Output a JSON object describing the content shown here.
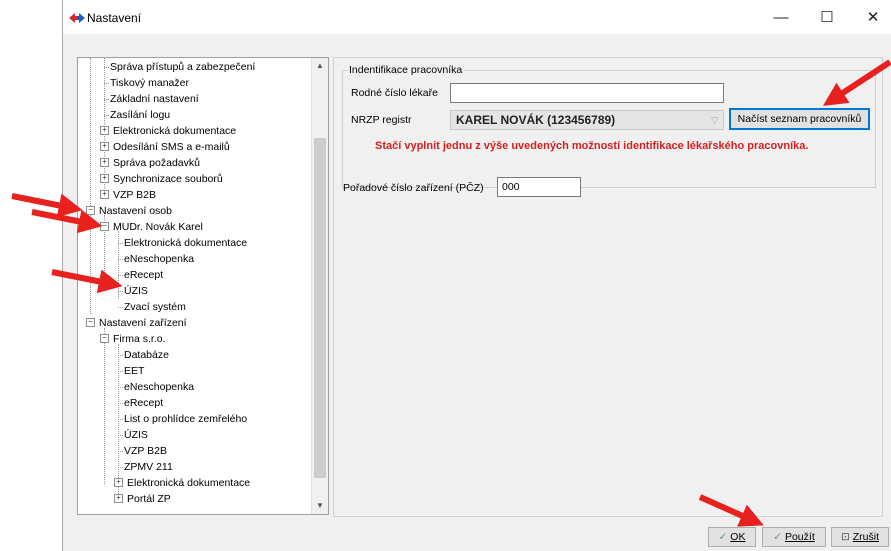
{
  "window": {
    "title": "Nastavení",
    "controls": {
      "minimize": "—",
      "maximize": "☐",
      "close": "✕"
    }
  },
  "tree": {
    "items": [
      {
        "label": "Správa přístupů a zabezpečení"
      },
      {
        "label": "Tiskový manažer"
      },
      {
        "label": "Základní nastavení"
      },
      {
        "label": "Zasílání logu"
      },
      {
        "label": "Elektronická dokumentace"
      },
      {
        "label": "Odesílání SMS a e-mailů"
      },
      {
        "label": "Správa požadavků"
      },
      {
        "label": "Synchronizace souborů"
      },
      {
        "label": "VZP B2B"
      },
      {
        "label": "Nastavení osob"
      },
      {
        "label": "MUDr. Novák Karel"
      },
      {
        "label": "Elektronická dokumentace"
      },
      {
        "label": "eNeschopenka"
      },
      {
        "label": "eRecept"
      },
      {
        "label": "ÚZIS"
      },
      {
        "label": "Zvací systém"
      },
      {
        "label": "Nastavení zařízení"
      },
      {
        "label": "Firma s.r.o."
      },
      {
        "label": "Databáze"
      },
      {
        "label": "EET"
      },
      {
        "label": "eNeschopenka"
      },
      {
        "label": "eRecept"
      },
      {
        "label": "List o prohlídce zemřelého"
      },
      {
        "label": "ÚZIS"
      },
      {
        "label": "VZP B2B"
      },
      {
        "label": "ZPMV 211"
      },
      {
        "label": "Elektronická dokumentace"
      },
      {
        "label": "Portál ZP"
      }
    ]
  },
  "form": {
    "group_title": "Indentifikace pracovníka",
    "rodne_cislo_label": "Rodné číslo lékaře",
    "rodne_cislo_value": "",
    "nrzp_label": "NRZP registr",
    "nrzp_value": "KAREL NOVÁK  (123456789)",
    "load_button": "Načíst seznam pracovníků",
    "hint": "Stačí vyplnit jednu z výše uvedených možností identifikace lékařského pracovníka.",
    "pcz_label": "Pořadové číslo zařízení (PČZ)",
    "pcz_value": "000"
  },
  "footer": {
    "ok": "OK",
    "apply": "Použít",
    "cancel": "Zrušit"
  },
  "colors": {
    "annotation_arrow": "#e8201e",
    "hint_text": "#d62020"
  }
}
